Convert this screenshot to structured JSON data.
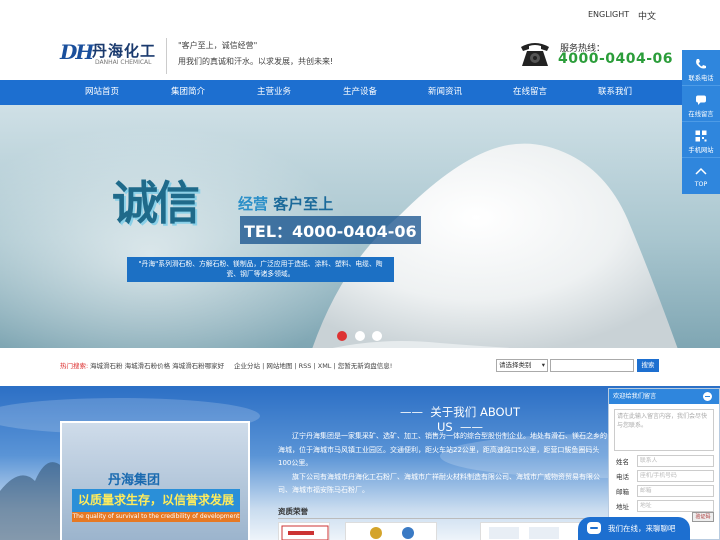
{
  "topbar": {
    "lang_en": "ENGLIGHT",
    "lang_cn": "中文"
  },
  "header": {
    "logo_mark": "DH",
    "logo_cn": "丹海化工",
    "logo_en": "DANHAI CHEMICAL",
    "slogan_line1": "\"客户至上，诚信经营\"",
    "slogan_line2": "用我们的真诚和汗水。以求发展，共创未来!",
    "service_label": "服务热线：",
    "service_number": "4000-0404-06"
  },
  "nav": {
    "items": [
      "网站首页",
      "集团简介",
      "主营业务",
      "生产设备",
      "新闻资讯",
      "在线留言",
      "联系我们"
    ]
  },
  "banner": {
    "calligraphy": "诚信",
    "headline_a": "经营",
    "headline_b": "客户至上",
    "tel": "TEL：4000-0404-06",
    "description": "\"丹海\"系列滑石粉、方解石粉、镁制品，广泛应用于造纸、涂料、塑料、电缆、陶瓷、钢厂等诸多领域。",
    "active_slide": 1,
    "slide_count": 3
  },
  "search": {
    "hot_label": "热门搜索:",
    "hot_links": "海城滑石粉  海城滑石粉价格  海城滑石粉哪家好",
    "quick_links": "企业分站 | 网站地图 | RSS | XML | 您暂无新询盘信息!",
    "category_select": "请选择类别",
    "button_label": "搜索"
  },
  "about": {
    "title_cn": "关于我们",
    "title_en": "ABOUT US",
    "para1": "辽宁丹海集团是一家集采矿、选矿、加工、销售为一体的综合型股份制企业。地处有滑石、镁石之乡的海城，位于海城市马风镇工业园区。交通便利，距火车站22公里，距高速路口5公里，距营口鲅鱼圈码头100公里。",
    "para2": "旗下公司有海城市丹海化工石粉厂、海城市广祥耐火材料制造有限公司、海城市广威物资贸易有限公司、海城市福安陈马石粉厂。",
    "cert_label": "资质荣誉",
    "photo_title": "丹海集团",
    "photo_motto": "以质量求生存，以信誉求发展",
    "photo_motto_en": "The quality of survival to the credibility of development"
  },
  "side_float": {
    "items": [
      {
        "icon": "phone-icon",
        "label": "联系电话"
      },
      {
        "icon": "message-icon",
        "label": "在线留言"
      },
      {
        "icon": "qrcode-icon",
        "label": "手机网站"
      },
      {
        "icon": "up-arrow-icon",
        "label": "TOP"
      }
    ]
  },
  "chat": {
    "header": "欢迎给我们留言",
    "message_placeholder": "请在此输入留言内容，我们会尽快与您联系。",
    "fields": [
      {
        "label": "姓名",
        "placeholder": "联系人"
      },
      {
        "label": "电话",
        "placeholder": "座机/手机号码"
      },
      {
        "label": "邮箱",
        "placeholder": "邮箱"
      },
      {
        "label": "地址",
        "placeholder": "地址"
      }
    ],
    "captcha": "验证码",
    "bubble_label": "我们在线，来聊聊吧"
  },
  "colors": {
    "nav_blue": "#1d6fd0",
    "service_green": "#2b9d3a",
    "accent_red": "#d33"
  }
}
